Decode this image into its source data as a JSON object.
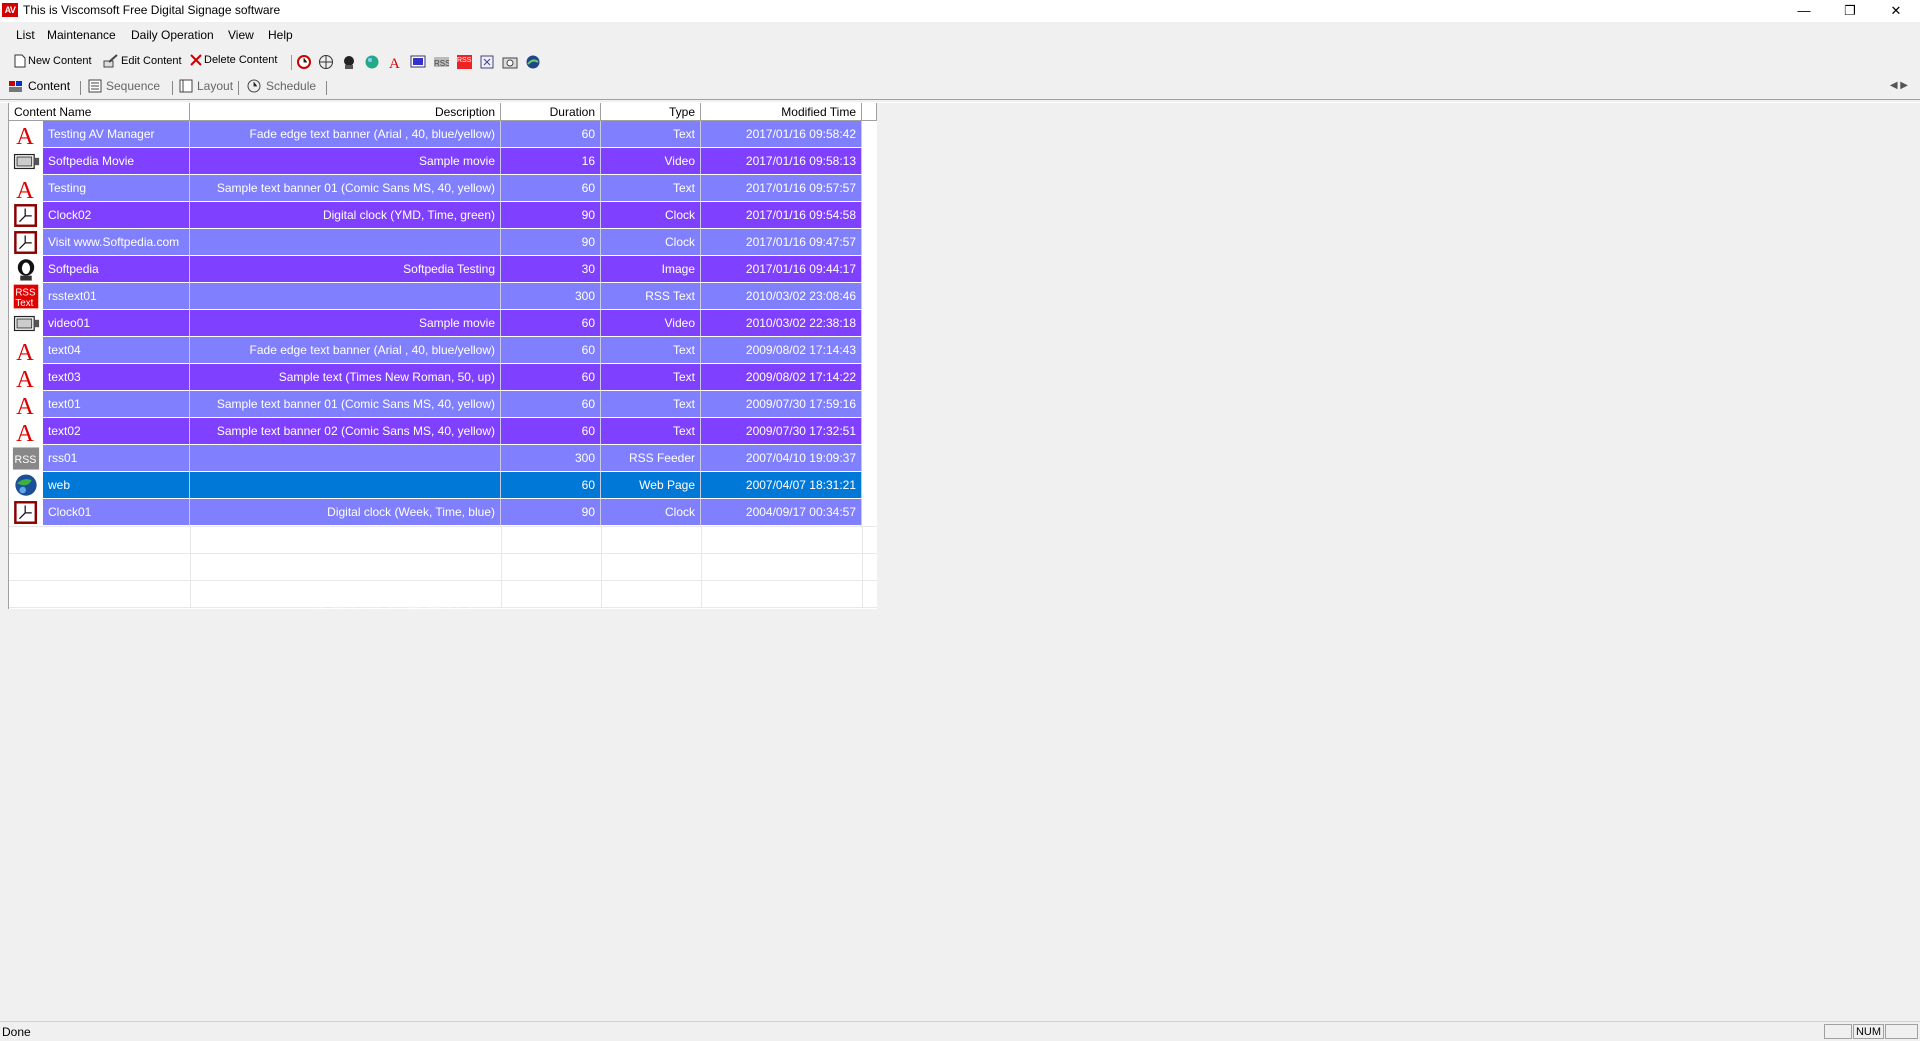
{
  "window": {
    "app_icon_text": "AV",
    "title": "This is Viscomsoft Free Digital Signage software",
    "minimize": "—",
    "restore": "❐",
    "close": "✕"
  },
  "menu": [
    "List",
    "Maintenance",
    "Daily Operation",
    "View",
    "Help"
  ],
  "toolbar": {
    "new_content": "New Content",
    "edit_content": "Edit Content",
    "delete_content": "Delete Content",
    "quick_icons": [
      "clock-icon",
      "globe-icon",
      "image-icon",
      "web-icon",
      "text-icon",
      "video-icon",
      "rss-icon",
      "rss-text-icon",
      "flash-icon",
      "camera-icon",
      "web-page-icon"
    ]
  },
  "tabs": [
    "Content",
    "Sequence",
    "Layout",
    "Schedule"
  ],
  "table": {
    "columns": [
      "Content Name",
      "Description",
      "Duration",
      "Type",
      "Modified Time"
    ],
    "rows": [
      {
        "icon": "text-icon",
        "name": "Testing AV Manager",
        "description": "Fade edge text banner (Arial , 40, blue/yellow)",
        "duration": "60",
        "type": "Text",
        "modified": "2017/01/16 09:58:42"
      },
      {
        "icon": "video-icon",
        "name": "Softpedia Movie",
        "description": "Sample movie",
        "duration": "16",
        "type": "Video",
        "modified": "2017/01/16 09:58:13"
      },
      {
        "icon": "text-icon",
        "name": "Testing",
        "description": "Sample text banner 01 (Comic Sans MS, 40, yellow)",
        "duration": "60",
        "type": "Text",
        "modified": "2017/01/16 09:57:57"
      },
      {
        "icon": "clock-icon",
        "name": "Clock02",
        "description": "Digital clock (YMD, Time, green)",
        "duration": "90",
        "type": "Clock",
        "modified": "2017/01/16 09:54:58"
      },
      {
        "icon": "clock-icon",
        "name": "Visit www.Softpedia.com",
        "description": "",
        "duration": "90",
        "type": "Clock",
        "modified": "2017/01/16 09:47:57"
      },
      {
        "icon": "image-icon",
        "name": "Softpedia",
        "description": "Softpedia Testing",
        "duration": "30",
        "type": "Image",
        "modified": "2017/01/16 09:44:17"
      },
      {
        "icon": "rss-text-icon",
        "name": "rsstext01",
        "description": "",
        "duration": "300",
        "type": "RSS Text",
        "modified": "2010/03/02 23:08:46"
      },
      {
        "icon": "video-icon",
        "name": "video01",
        "description": "Sample movie",
        "duration": "60",
        "type": "Video",
        "modified": "2010/03/02 22:38:18"
      },
      {
        "icon": "text-icon",
        "name": "text04",
        "description": "Fade edge text banner (Arial , 40, blue/yellow)",
        "duration": "60",
        "type": "Text",
        "modified": "2009/08/02 17:14:43"
      },
      {
        "icon": "text-icon",
        "name": "text03",
        "description": "Sample text (Times New Roman, 50, up)",
        "duration": "60",
        "type": "Text",
        "modified": "2009/08/02 17:14:22"
      },
      {
        "icon": "text-icon",
        "name": "text01",
        "description": "Sample text banner 01 (Comic Sans MS, 40, yellow)",
        "duration": "60",
        "type": "Text",
        "modified": "2009/07/30 17:59:16"
      },
      {
        "icon": "text-icon",
        "name": "text02",
        "description": "Sample text banner 02 (Comic Sans MS, 40, yellow)",
        "duration": "60",
        "type": "Text",
        "modified": "2009/07/30 17:32:51"
      },
      {
        "icon": "rss-icon",
        "name": "rss01",
        "description": "",
        "duration": "300",
        "type": "RSS Feeder",
        "modified": "2007/04/10 19:09:37"
      },
      {
        "icon": "web-icon",
        "name": "web",
        "description": "",
        "duration": "60",
        "type": "Web Page",
        "modified": "2007/04/07 18:31:21",
        "selected": true
      },
      {
        "icon": "clock-icon",
        "name": "Clock01",
        "description": "Digital clock (Week, Time, blue)",
        "duration": "90",
        "type": "Clock",
        "modified": "2004/09/17 00:34:57"
      }
    ]
  },
  "icon_labels": {
    "rss": "RSS",
    "rss_text_1": "RSS",
    "rss_text_2": "Text",
    "text_glyph": "A"
  },
  "watermark": "SOFTPEDIA",
  "colors": {
    "row_light": "#8080ff",
    "row_dark": "#8040ff",
    "row_selected": "#0078d7"
  },
  "status": {
    "text": "Done",
    "panel_num": "NUM"
  }
}
